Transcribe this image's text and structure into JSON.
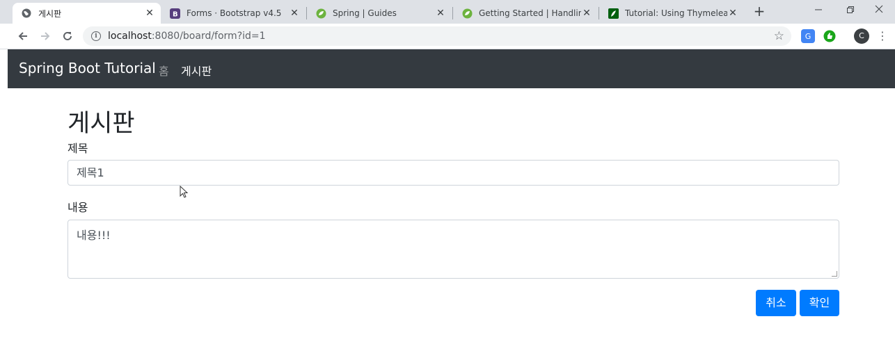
{
  "browser": {
    "tabs": [
      {
        "title": "게시판",
        "active": true,
        "favicon": "globe-icon"
      },
      {
        "title": "Forms · Bootstrap v4.5",
        "favicon": "bootstrap-icon"
      },
      {
        "title": "Spring | Guides",
        "favicon": "spring-leaf-icon"
      },
      {
        "title": "Getting Started | Handling",
        "favicon": "spring-leaf-icon"
      },
      {
        "title": "Tutorial: Using Thymeleaf",
        "favicon": "thymeleaf-icon"
      }
    ],
    "close_glyph": "✕",
    "new_tab_glyph": "+",
    "url_host": "localhost",
    "url_rest": ":8080/board/form?id=1",
    "avatar_letter": "C"
  },
  "navbar": {
    "brand": "Spring Boot Tutorial",
    "links": [
      "홈",
      "게시판"
    ]
  },
  "form": {
    "heading": "게시판",
    "title_label": "제목",
    "title_value": "제목1",
    "content_label": "내용",
    "content_value": "내용!!!",
    "cancel_label": "취소",
    "submit_label": "확인"
  },
  "colors": {
    "navbar_bg": "#343a40",
    "primary": "#007bff",
    "tabstrip_bg": "#dee1e6"
  }
}
